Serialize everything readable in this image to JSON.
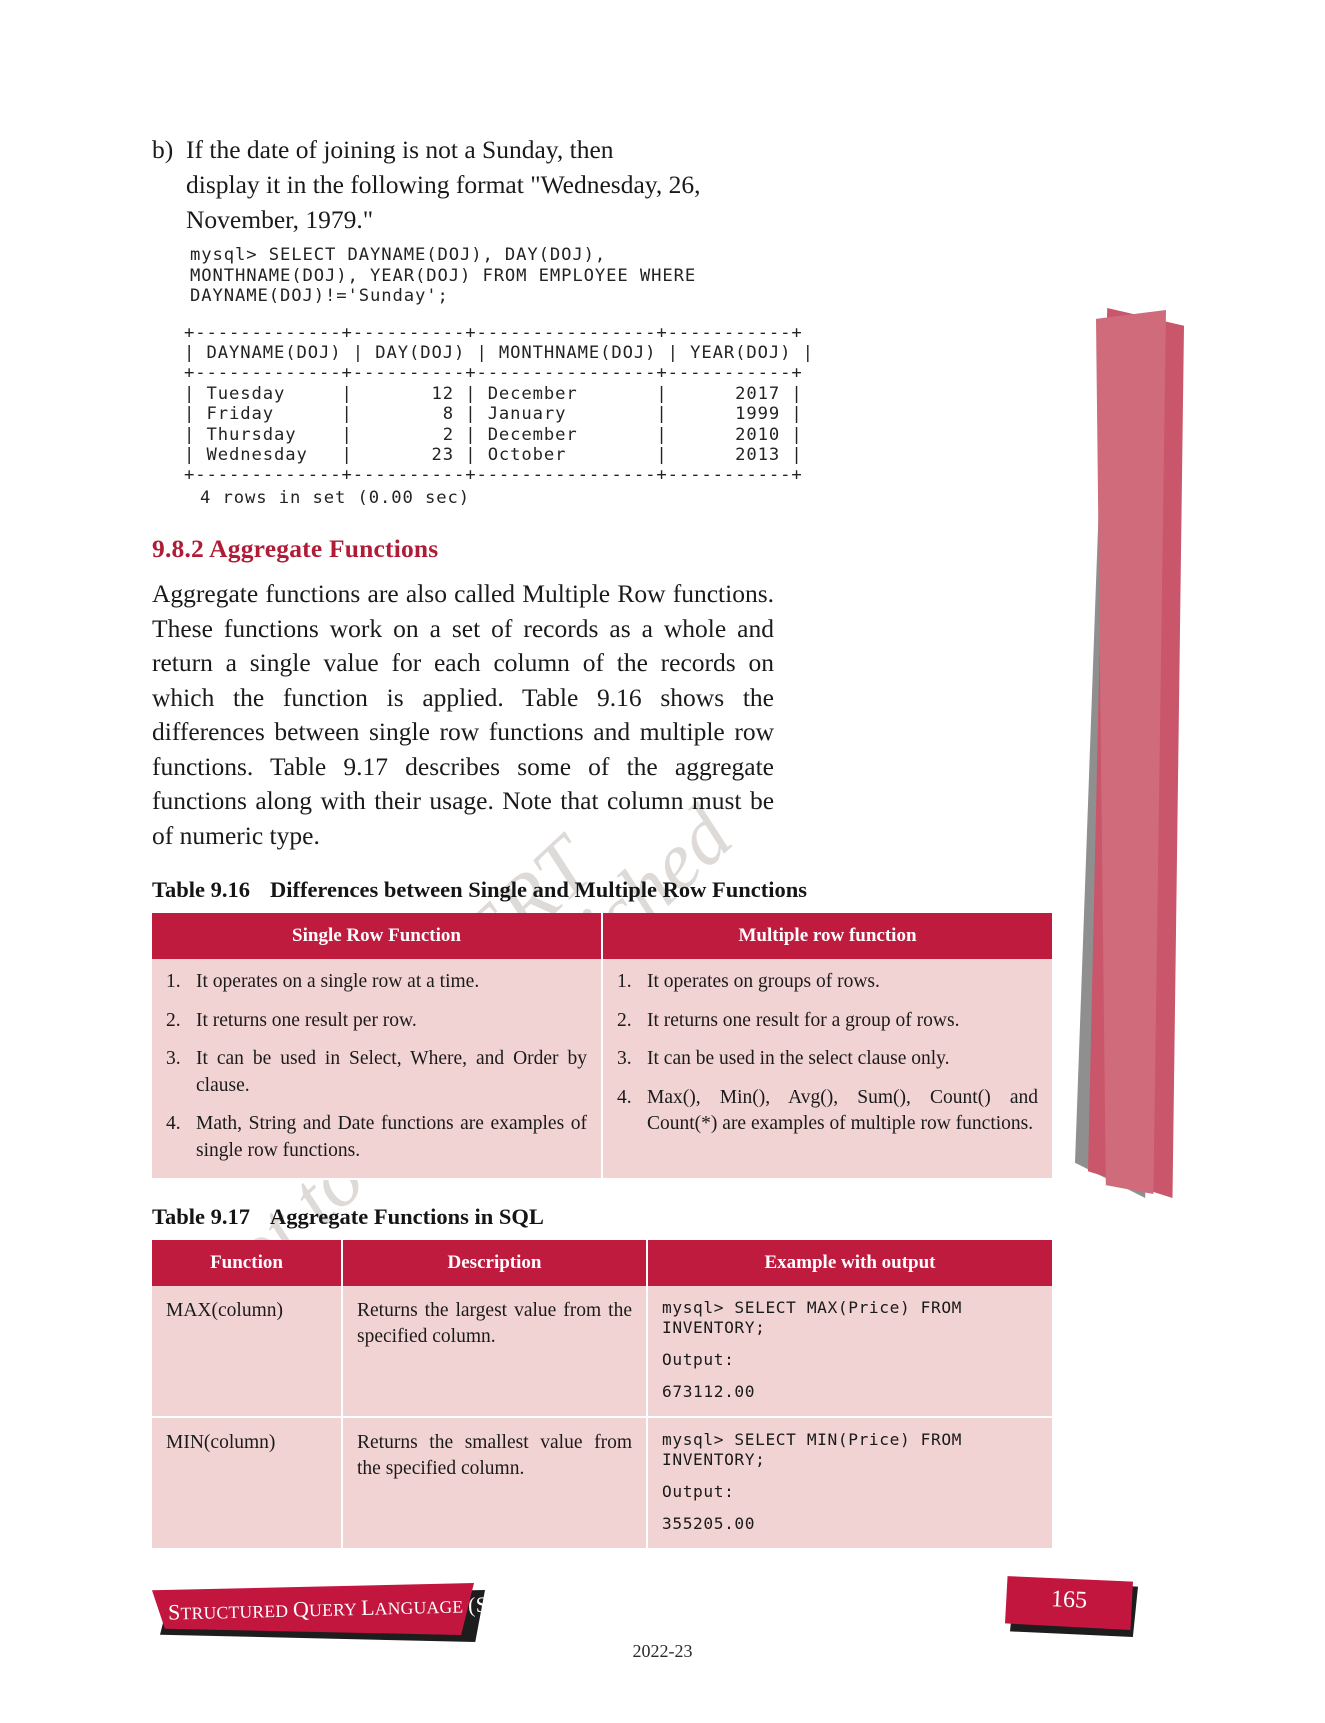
{
  "colors": {
    "accent": "#b01b36",
    "table_header_bg": "#bf1b3f",
    "table_cell_bg": "#f2d3d3",
    "footer_red": "#c2163f"
  },
  "question": {
    "marker": "b)",
    "lines": [
      "If the date of joining is not a Sunday, then",
      "display it in the following format \"Wednesday, 26,",
      "November, 1979.\""
    ]
  },
  "query_code": "mysql> SELECT DAYNAME(DOJ), DAY(DOJ),\nMONTHNAME(DOJ), YEAR(DOJ) FROM EMPLOYEE WHERE\nDAYNAME(DOJ)!='Sunday';",
  "result_table": {
    "ascii": "+-------------+----------+----------------+-----------+\n| DAYNAME(DOJ) | DAY(DOJ) | MONTHNAME(DOJ) | YEAR(DOJ) |\n+-------------+----------+----------------+-----------+\n| Tuesday     |       12 | December       |      2017 |\n| Friday      |        8 | January        |      1999 |\n| Thursday    |        2 | December       |      2010 |\n| Wednesday   |       23 | October        |      2013 |\n+-------------+----------+----------------+-----------+",
    "columns": [
      "DAYNAME(DOJ)",
      "DAY(DOJ)",
      "MONTHNAME(DOJ)",
      "YEAR(DOJ)"
    ],
    "rows": [
      [
        "Tuesday",
        "12",
        "December",
        "2017"
      ],
      [
        "Friday",
        "8",
        "January",
        "1999"
      ],
      [
        "Thursday",
        "2",
        "December",
        "2010"
      ],
      [
        "Wednesday",
        "23",
        "October",
        "2013"
      ]
    ],
    "footer": "4 rows in set (0.00 sec)"
  },
  "section": {
    "heading": "9.8.2 Aggregate Functions",
    "paragraph_lines": [
      "Aggregate functions are also called Multiple Row",
      "functions. These functions work on a set of records as",
      "a whole and return a single value for each column of",
      "the records on which the function is applied. Table 9.16",
      "shows the differences between single row functions and",
      "multiple row functions. Table 9.17 describes some of",
      "the aggregate functions along with their usage. Note",
      "that column must be of numeric type."
    ]
  },
  "table_916": {
    "caption_num": "Table 9.16",
    "caption_text": "Differences between Single and Multiple Row Functions",
    "headers": [
      "Single Row Function",
      "Multiple row function"
    ],
    "left_items": [
      {
        "num": "1.",
        "text": "It operates on a single row at a time."
      },
      {
        "num": "2.",
        "text": "It returns one result per row."
      },
      {
        "num": "3.",
        "text": "It can be used in Select, Where, and Order by clause."
      },
      {
        "num": "4.",
        "text": "Math, String and Date functions are examples of single row functions."
      }
    ],
    "right_items": [
      {
        "num": "1.",
        "text": "It operates on groups of rows."
      },
      {
        "num": "2.",
        "text": "It returns one result for a group of rows."
      },
      {
        "num": "3.",
        "text": "It can be used in the select clause only."
      },
      {
        "num": "4.",
        "text": "Max(), Min(), Avg(), Sum(), Count() and Count(*) are examples of multiple row functions."
      }
    ]
  },
  "table_917": {
    "caption_num": "Table 9.17",
    "caption_text": "Aggregate Functions in SQL",
    "headers": [
      "Function",
      "Description",
      "Example with output"
    ],
    "rows": [
      {
        "function": "MAX(column)",
        "description": "Returns the largest value from the specified column.",
        "query": "mysql> SELECT MAX(Price) FROM\nINVENTORY;",
        "output_label": "Output:",
        "output_value": "673112.00"
      },
      {
        "function": "MIN(column)",
        "description": "Returns the smallest value from the specified column.",
        "query": "mysql> SELECT MIN(Price) FROM\nINVENTORY;",
        "output_label": "Output:",
        "output_value": "355205.00"
      }
    ]
  },
  "watermark": {
    "line1": "© NCERT",
    "line2": "not to be republished"
  },
  "footer": {
    "running_title_small_caps": "S",
    "running_title": "Structured Query Language (SQL)",
    "running_title_parts": [
      "S",
      "TRUCTURED ",
      "Q",
      "UERY ",
      "L",
      "ANGUAGE ",
      "(SQL)"
    ],
    "page_number": "165",
    "year": "2022-23"
  }
}
